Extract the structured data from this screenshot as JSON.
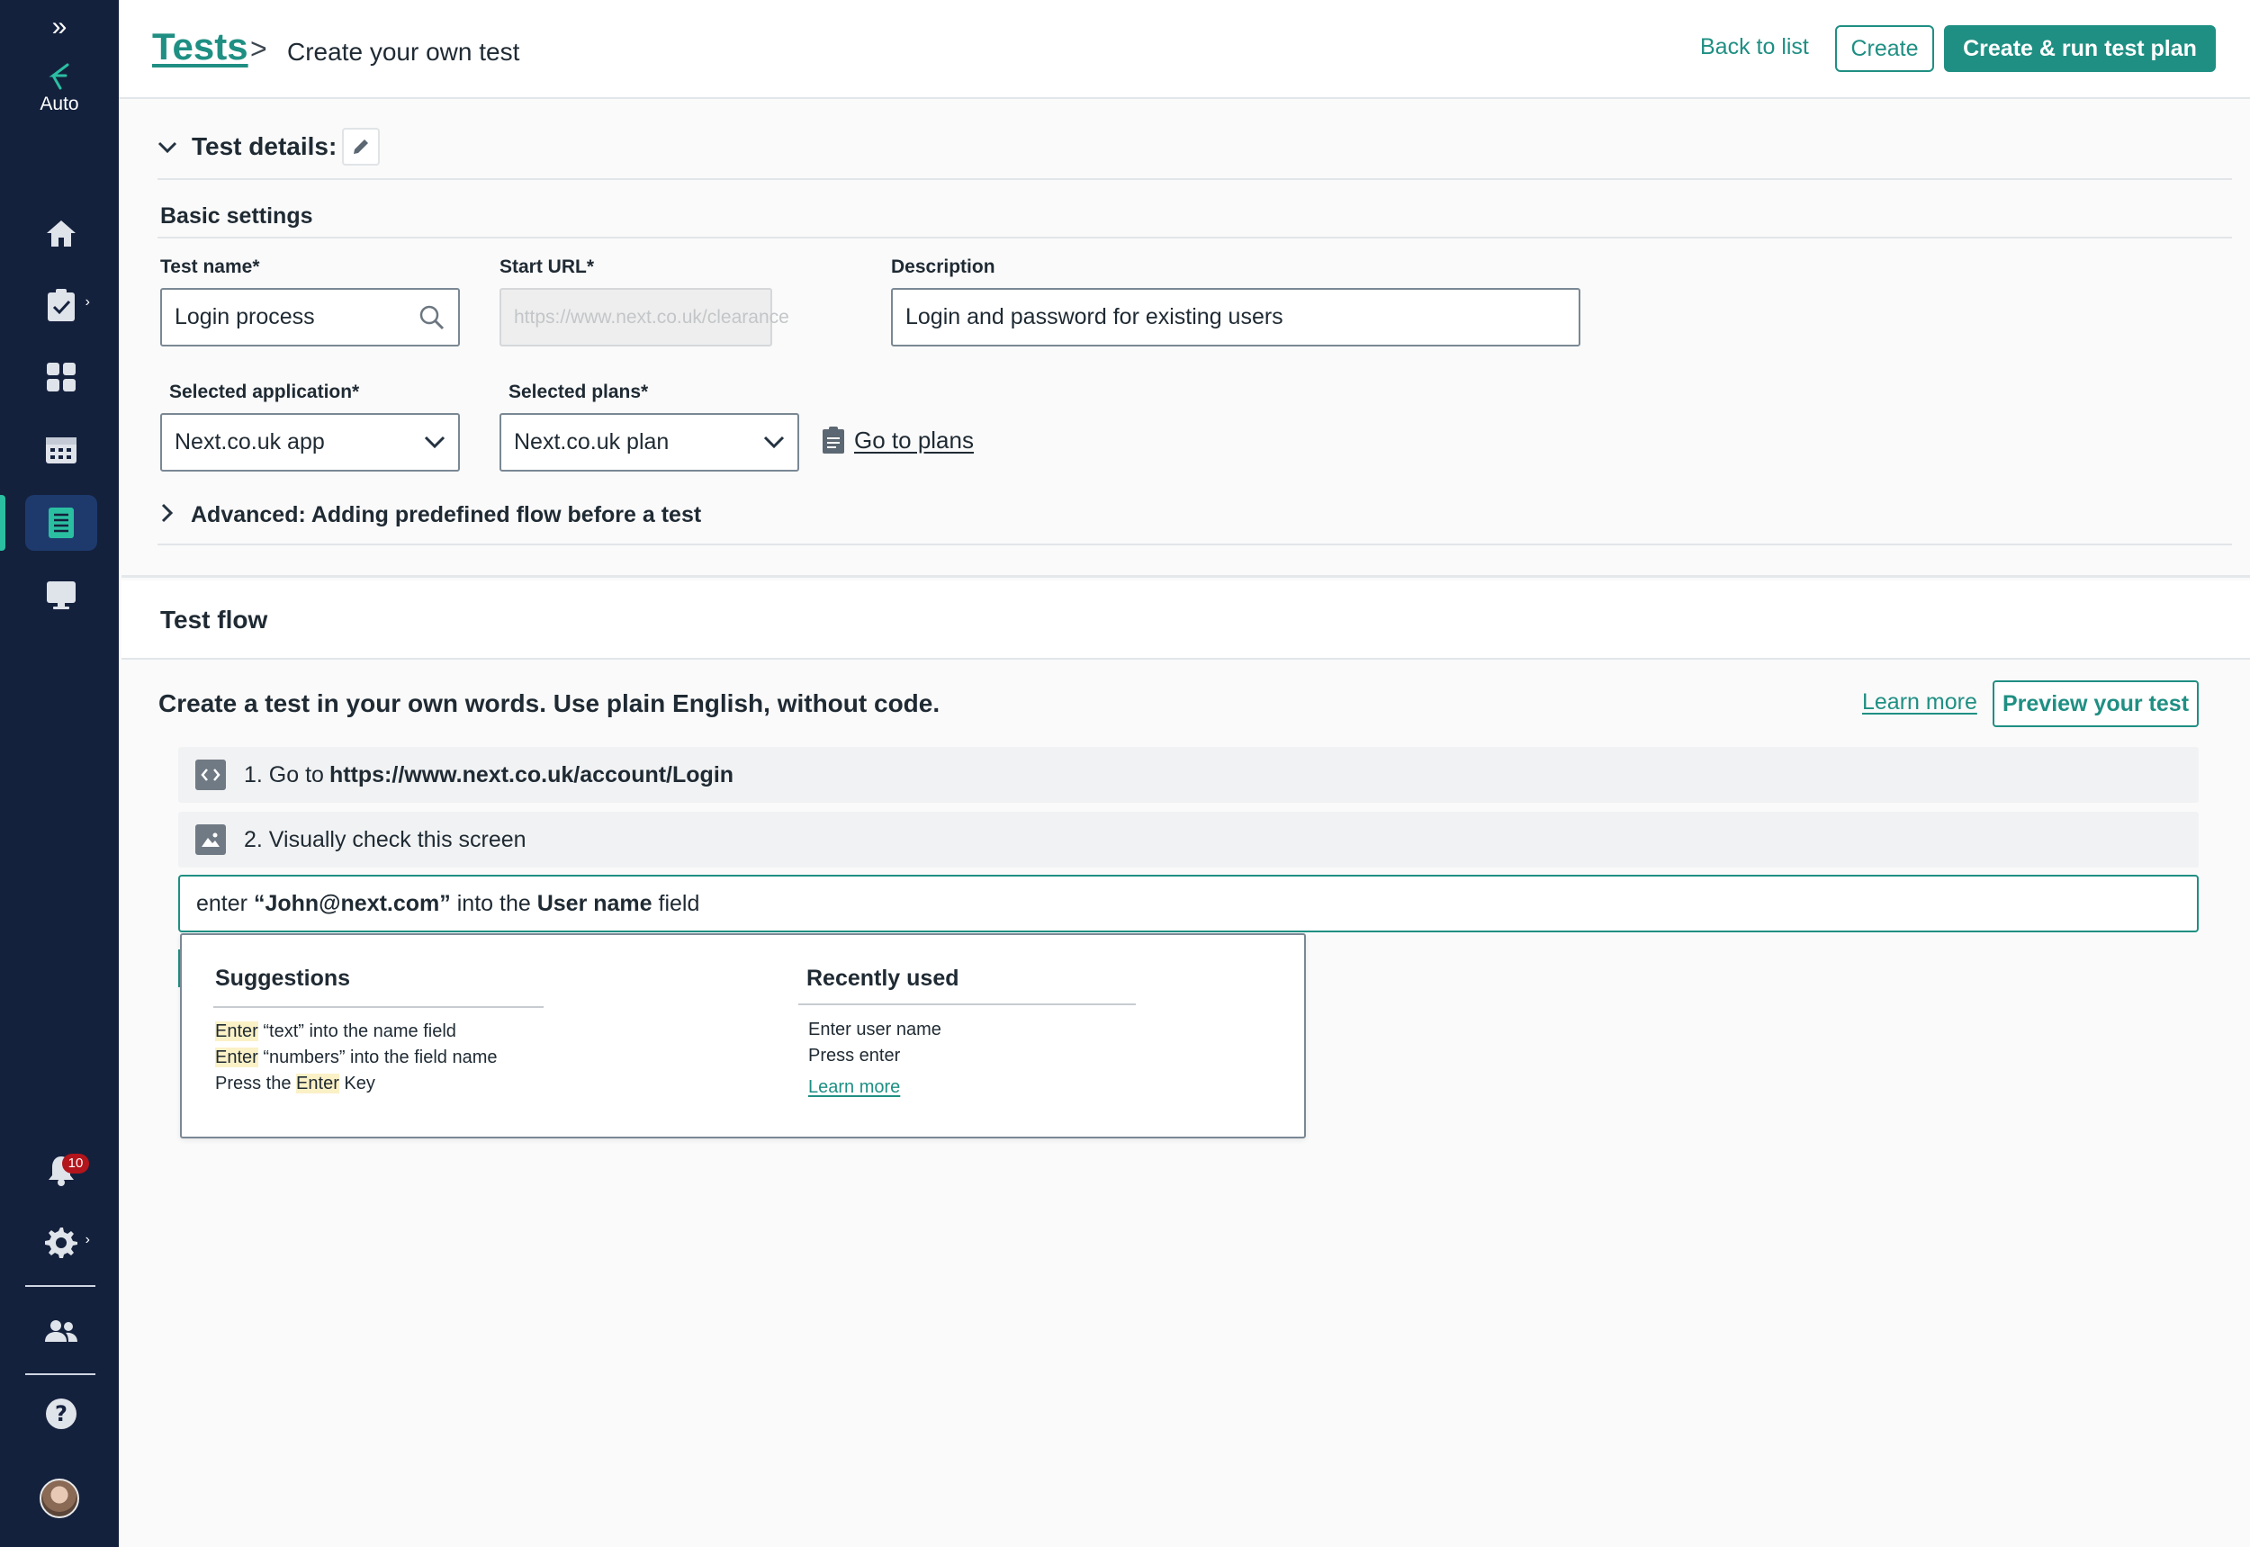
{
  "sidebar": {
    "logo_text": "Auto",
    "notification_count": "10"
  },
  "header": {
    "breadcrumb_root": "Tests",
    "breadcrumb_current": "Create your own test",
    "back_label": "Back to list",
    "create_label": "Create",
    "create_run_label": "Create & run test plan"
  },
  "details": {
    "title": "Test details:",
    "basic_settings": "Basic settings",
    "test_name_label": "Test name*",
    "test_name_value": "Login process",
    "start_url_label": "Start URL*",
    "start_url_placeholder": "https://www.next.co.uk/clearance",
    "description_label": "Description",
    "description_value": "Login and password for existing users",
    "app_label": "Selected application*",
    "app_value": "Next.co.uk app",
    "plans_label": "Selected plans*",
    "plans_value": "Next.co.uk plan",
    "go_to_plans": "Go to plans",
    "advanced": "Advanced: Adding predefined flow before a test"
  },
  "flow": {
    "title": "Test flow",
    "subtitle": "Create a test in your own words. Use plain English, without code.",
    "learn_more": "Learn more",
    "preview_label": "Preview your test",
    "steps": [
      {
        "prefix": "1. Go to",
        "bold": "https://www.next.co.uk/account/Login"
      },
      {
        "prefix": "2. Visually check this screen",
        "bold": ""
      }
    ],
    "input": {
      "part1": "enter ",
      "bold1": "“John@next.com”",
      "part2": " into the ",
      "bold2": "User name",
      "part3": " field"
    }
  },
  "popup": {
    "suggestions_title": "Suggestions",
    "suggestions": [
      {
        "pre": "",
        "hl": "Enter",
        "post": " “text” into the name field"
      },
      {
        "pre": "",
        "hl": "Enter",
        "post": " “numbers” into the field name"
      },
      {
        "pre": "Press the ",
        "hl": "Enter",
        "post": " Key"
      }
    ],
    "recent_title": "Recently used",
    "recent": [
      "Enter user name",
      "Press enter"
    ],
    "learn_more": "Learn more"
  },
  "colors": {
    "accent": "#1f8f83",
    "sidebar_bg": "#14213d",
    "badge": "#b3151c",
    "highlight": "#fbf1c6"
  }
}
